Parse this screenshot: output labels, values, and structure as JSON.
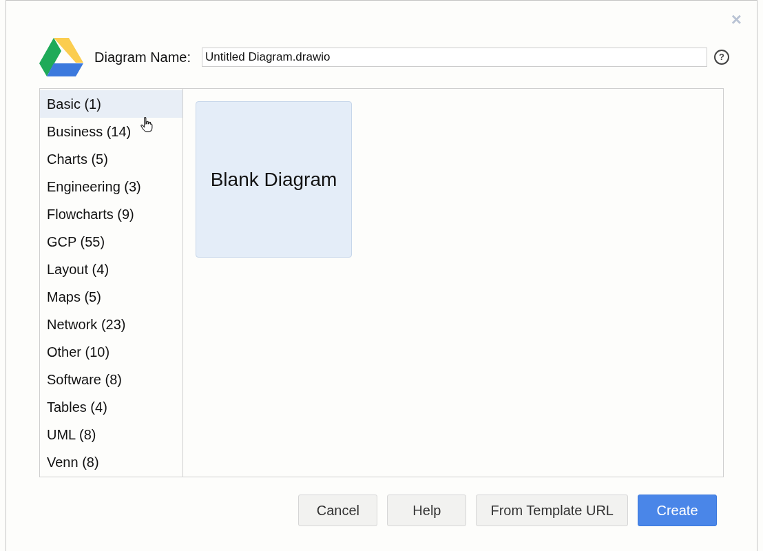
{
  "dialog": {
    "close_label": "×",
    "name_label": "Diagram Name:",
    "name_value": "Untitled Diagram.drawio",
    "help_label": "?"
  },
  "categories": [
    {
      "label": "Basic (1)",
      "selected": true
    },
    {
      "label": "Business (14)",
      "selected": false
    },
    {
      "label": "Charts (5)",
      "selected": false
    },
    {
      "label": "Engineering (3)",
      "selected": false
    },
    {
      "label": "Flowcharts (9)",
      "selected": false
    },
    {
      "label": "GCP (55)",
      "selected": false
    },
    {
      "label": "Layout (4)",
      "selected": false
    },
    {
      "label": "Maps (5)",
      "selected": false
    },
    {
      "label": "Network (23)",
      "selected": false
    },
    {
      "label": "Other (10)",
      "selected": false
    },
    {
      "label": "Software (8)",
      "selected": false
    },
    {
      "label": "Tables (4)",
      "selected": false
    },
    {
      "label": "UML (8)",
      "selected": false
    },
    {
      "label": "Venn (8)",
      "selected": false
    }
  ],
  "templates": [
    {
      "label": "Blank Diagram"
    }
  ],
  "buttons": [
    {
      "label": "Cancel",
      "kind": "default"
    },
    {
      "label": "Help",
      "kind": "default"
    },
    {
      "label": "From Template URL",
      "kind": "default"
    },
    {
      "label": "Create",
      "kind": "primary"
    }
  ]
}
